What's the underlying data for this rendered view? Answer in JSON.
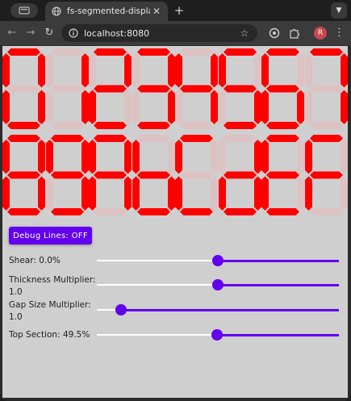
{
  "browser": {
    "tab_title": "fs-segmented-display",
    "tab_close_glyph": "✕",
    "new_tab_glyph": "+",
    "url": "localhost:8080",
    "profile_initial": "R",
    "icons": [
      "tab-search-icon",
      "globe-icon",
      "close-icon",
      "plus-icon",
      "chevron-down-icon",
      "back-arrow-icon",
      "forward-arrow-icon",
      "reload-icon",
      "site-info-icon",
      "star-icon",
      "extension-icon",
      "puzzle-icon",
      "avatar",
      "kebab-menu-icon"
    ]
  },
  "display": {
    "rows": [
      [
        "0",
        "1",
        "2",
        "3",
        "4",
        "5",
        "6",
        "7"
      ],
      [
        "8",
        "9",
        "A",
        "b",
        "C",
        "d",
        "E",
        "F"
      ]
    ],
    "on_color": "#ff0000",
    "off_color": "#dcc2c2"
  },
  "controls": {
    "debug_button_label": "Debug Lines: OFF",
    "sliders": [
      {
        "label": "Shear: 0.0%",
        "value": 0.5
      },
      {
        "label": "Thickness Multiplier:\n1.0",
        "value": 0.5
      },
      {
        "label": "Gap Size Multiplier:\n1.0",
        "value": 0.1
      },
      {
        "label": "Top Section: 49.5%",
        "value": 0.495
      }
    ],
    "accent_color": "#6200ee"
  }
}
